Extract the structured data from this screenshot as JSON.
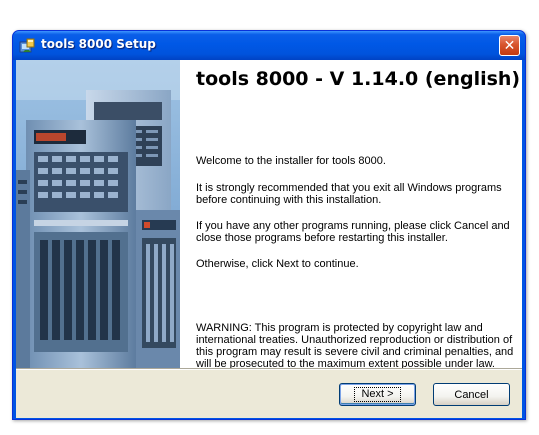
{
  "window": {
    "title": "tools 8000 Setup",
    "close_glyph": "✕",
    "icon": "setup-icon"
  },
  "main": {
    "heading": "tools 8000 - V 1.14.0 (english)",
    "paragraphs": [
      "Welcome to the installer for tools 8000.",
      "It is strongly recommended that you exit all Windows programs before continuing with this installation.",
      "If you have any other programs running, please click Cancel and close those programs before restarting this installer.",
      "Otherwise, click Next to continue.",
      "WARNING: This program is protected by copyright law and international treaties.  Unauthorized reproduction or distribution of this program may result is severe civil and criminal penalties, and will be prosecuted to the maximum extent possible under law."
    ]
  },
  "buttons": {
    "next_label": "Next >",
    "cancel_label": "Cancel"
  },
  "colors": {
    "titlebar": "#0058e6",
    "close_button": "#d8552e",
    "dialog_face": "#ece9d8",
    "button_border": "#003c74"
  }
}
